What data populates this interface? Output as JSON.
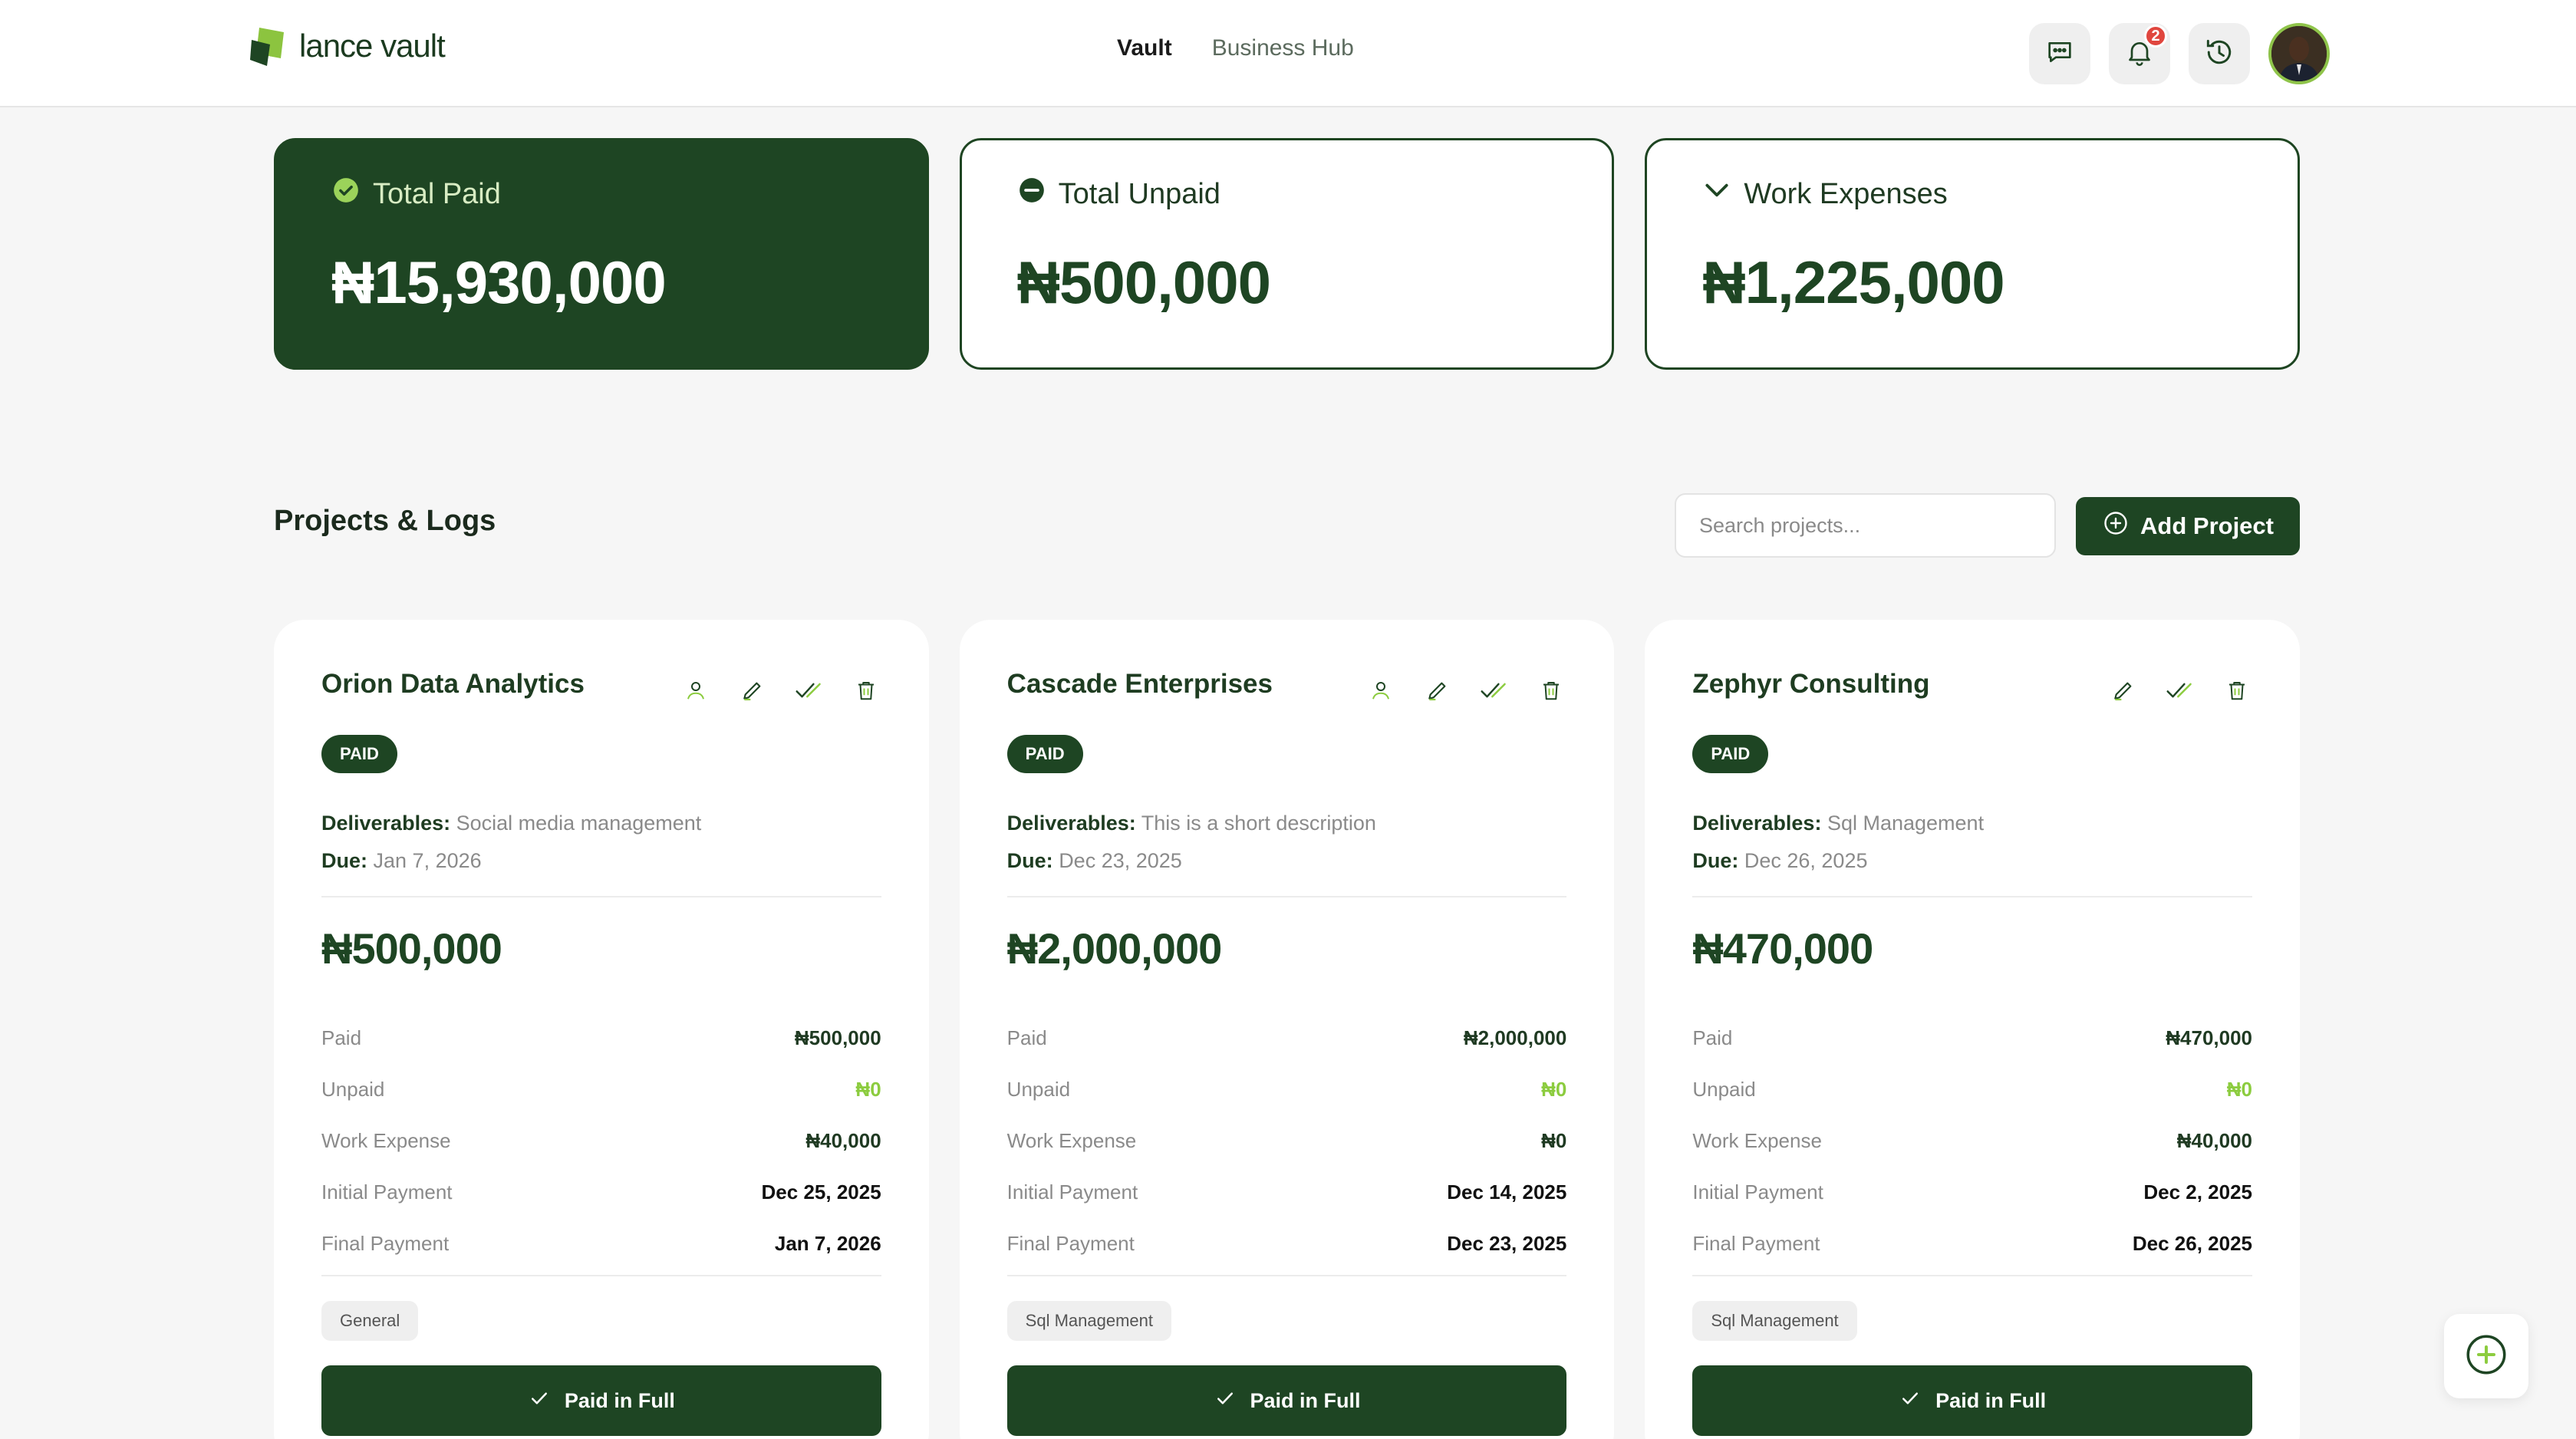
{
  "header": {
    "logo_text": "lance vault",
    "nav": [
      {
        "label": "Vault",
        "active": true
      },
      {
        "label": "Business Hub",
        "active": false
      }
    ],
    "icons": [
      "chat-icon",
      "bell-icon",
      "history-icon"
    ],
    "notification_count": "2"
  },
  "summary": [
    {
      "label": "Total Paid",
      "value": "₦15,930,000",
      "icon": "check-circle-icon",
      "style": "dark"
    },
    {
      "label": "Total Unpaid",
      "value": "₦500,000",
      "icon": "minus-circle-icon",
      "style": "light"
    },
    {
      "label": "Work Expenses",
      "value": "₦1,225,000",
      "icon": "chevron-down-icon",
      "style": "light"
    }
  ],
  "projects": {
    "title": "Projects & Logs",
    "search_placeholder": "Search projects...",
    "add_label": "Add Project",
    "labels": {
      "deliverables": "Deliverables:",
      "due": "Due:",
      "paid": "Paid",
      "unpaid": "Unpaid",
      "work_expense": "Work Expense",
      "initial_payment": "Initial Payment",
      "final_payment": "Final Payment"
    },
    "cards": [
      {
        "name": "Orion Data Analytics",
        "status": "PAID",
        "deliverables": "Social media management",
        "due": "Jan 7, 2026",
        "amount": "₦500,000",
        "paid": "₦500,000",
        "unpaid": "₦0",
        "work_expense": "₦40,000",
        "initial_payment": "Dec 25, 2025",
        "final_payment": "Jan 7, 2026",
        "tag": "General",
        "button": "Paid in Full",
        "has_client_icon": true
      },
      {
        "name": "Cascade Enterprises",
        "status": "PAID",
        "deliverables": "This is a short description",
        "due": "Dec 23, 2025",
        "amount": "₦2,000,000",
        "paid": "₦2,000,000",
        "unpaid": "₦0",
        "work_expense": "₦0",
        "initial_payment": "Dec 14, 2025",
        "final_payment": "Dec 23, 2025",
        "tag": "Sql Management",
        "button": "Paid in Full",
        "has_client_icon": true
      },
      {
        "name": "Zephyr Consulting",
        "status": "PAID",
        "deliverables": "Sql Management",
        "due": "Dec 26, 2025",
        "amount": "₦470,000",
        "paid": "₦470,000",
        "unpaid": "₦0",
        "work_expense": "₦40,000",
        "initial_payment": "Dec 2, 2025",
        "final_payment": "Dec 26, 2025",
        "tag": "Sql Management",
        "button": "Paid in Full",
        "has_client_icon": false
      }
    ]
  },
  "colors": {
    "brand_dark": "#1e4523",
    "accent_green": "#8ccc3f",
    "badge_red": "#e0463e"
  }
}
